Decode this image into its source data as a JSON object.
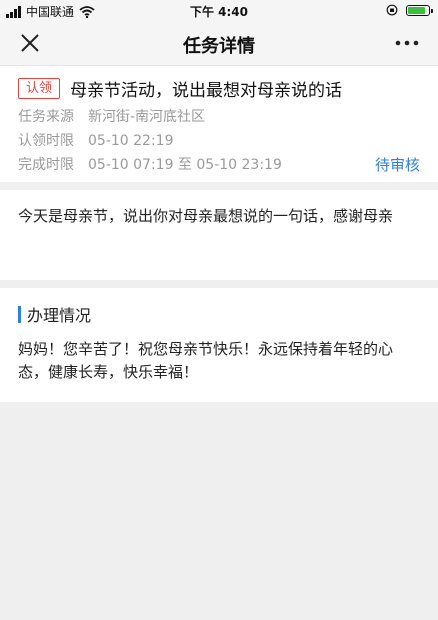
{
  "status_bar": {
    "carrier": "中国联通",
    "time": "下午 4:40",
    "battery_level": 0.85,
    "battery_color": "#3cbf3c"
  },
  "nav": {
    "title": "任务详情",
    "close_icon": "close-icon",
    "more_icon": "more-icon"
  },
  "task": {
    "badge": "认领",
    "title": "母亲节活动，说出最想对母亲说的话",
    "source_label": "任务来源",
    "source_value": "新河街-南河底社区",
    "claim_label": "认领时限",
    "claim_value": "05-10 22:19",
    "complete_label": "完成时限",
    "complete_value": "05-10 07:19 至 05-10 23:19",
    "status": "待审核"
  },
  "description": "今天是母亲节，说出你对母亲最想说的一句话，感谢母亲",
  "progress": {
    "heading": "办理情况",
    "content": "妈妈！您辛苦了！祝您母亲节快乐！永远保持着年轻的心态，健康长寿，快乐幸福！"
  },
  "colors": {
    "accent": "#2f7fe0",
    "badge": "#e0453a",
    "background": "#efefef"
  }
}
